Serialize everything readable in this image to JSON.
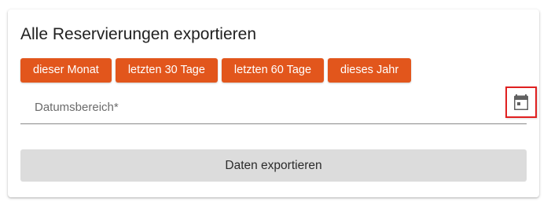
{
  "card": {
    "title": "Alle Reservierungen exportieren"
  },
  "quick_ranges": [
    {
      "label": "dieser Monat"
    },
    {
      "label": "letzten 30 Tage"
    },
    {
      "label": "letzten 60 Tage"
    },
    {
      "label": "dieses Jahr"
    }
  ],
  "date_range": {
    "placeholder": "Datumsbereich*",
    "value": "",
    "icon": "calendar-icon"
  },
  "export": {
    "label": "Daten exportieren"
  },
  "colors": {
    "accent": "#e2561c",
    "export_button_bg": "#dcdcdc",
    "highlight_border": "#e02020",
    "icon": "#616161"
  }
}
